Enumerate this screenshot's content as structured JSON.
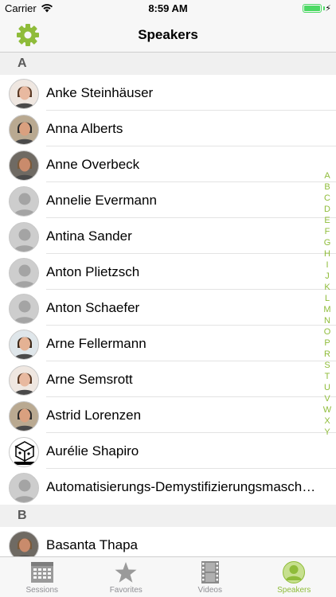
{
  "status_bar": {
    "carrier": "Carrier",
    "time": "8:59 AM",
    "battery_level": 1.0
  },
  "nav": {
    "title": "Speakers",
    "settings_icon": "gear-icon"
  },
  "colors": {
    "accent": "#8fbc3a",
    "inactive": "#8e8e93"
  },
  "sections": [
    {
      "letter": "A",
      "speakers": [
        {
          "name": "Anke Steinhäuser",
          "avatar": "photo"
        },
        {
          "name": "Anna Alberts",
          "avatar": "photo"
        },
        {
          "name": "Anne Overbeck",
          "avatar": "photo"
        },
        {
          "name": "Annelie Evermann",
          "avatar": "placeholder"
        },
        {
          "name": "Antina Sander",
          "avatar": "placeholder"
        },
        {
          "name": "Anton Plietzsch",
          "avatar": "placeholder"
        },
        {
          "name": "Anton Schaefer",
          "avatar": "placeholder"
        },
        {
          "name": "Arne Fellermann",
          "avatar": "photo"
        },
        {
          "name": "Arne Semsrott",
          "avatar": "photo"
        },
        {
          "name": "Astrid Lorenzen",
          "avatar": "photo"
        },
        {
          "name": "Aurélie Shapiro",
          "avatar": "logo"
        },
        {
          "name": "Automatisierungs-Demystifizierungsmaschine",
          "avatar": "placeholder"
        }
      ]
    },
    {
      "letter": "B",
      "speakers": [
        {
          "name": "Basanta Thapa",
          "avatar": "photo"
        }
      ]
    }
  ],
  "index_letters": [
    "A",
    "B",
    "C",
    "D",
    "E",
    "F",
    "G",
    "H",
    "I",
    "J",
    "K",
    "L",
    "M",
    "N",
    "O",
    "P",
    "R",
    "S",
    "T",
    "U",
    "V",
    "W",
    "X",
    "Y"
  ],
  "tabs": [
    {
      "label": "Sessions",
      "icon": "calendar-icon",
      "active": false
    },
    {
      "label": "Favorites",
      "icon": "star-icon",
      "active": false
    },
    {
      "label": "Videos",
      "icon": "film-icon",
      "active": false
    },
    {
      "label": "Speakers",
      "icon": "person-icon",
      "active": true
    }
  ]
}
